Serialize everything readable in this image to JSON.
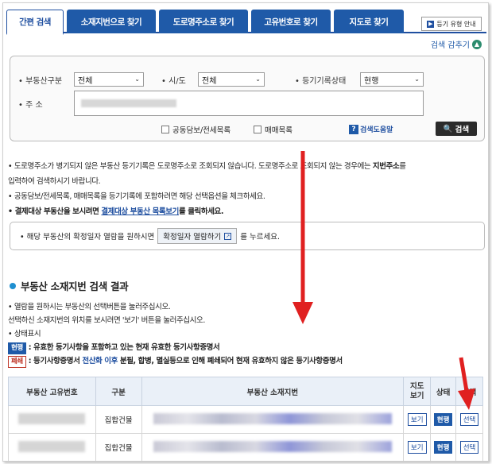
{
  "tabs": [
    {
      "label": "간편 검색",
      "active": true
    },
    {
      "label": "소재지번으로 찾기"
    },
    {
      "label": "도로명주소로 찾기"
    },
    {
      "label": "고유번호로 찾기"
    },
    {
      "label": "지도로 찾기"
    }
  ],
  "guide_button": "등기 유형 안내",
  "fold_label": "검색 감추기",
  "search": {
    "property_type": {
      "label": "• 부동산구분",
      "value": "전체"
    },
    "sido": {
      "label": "• 시/도",
      "value": "전체"
    },
    "record_status": {
      "label": "• 등기기록상태",
      "value": "현행"
    },
    "address": {
      "label": "• 주  소"
    },
    "check_joint": "공동담보/전세목록",
    "check_trade": "매매목록",
    "help": "검색도움말",
    "search_button": "검색"
  },
  "notes": {
    "line1a": "• 도로명주소가 병기되지 않은 부동산 등기기록은 도로명주소로 조회되지 않습니다. 도로명주소로 조회되지 않는 경우에는 ",
    "line1b": "지번주소",
    "line1c": "를",
    "line2": "  입력하여 검색하시기 바랍니다.",
    "line3": "• 공동담보/전세목록, 매매목록을 등기기록에 포함하려면 해당 선택옵션을 체크하세요.",
    "line4a": "• 결제대상 부동산을 보시려면 ",
    "line4b": "결제대상 부동산 목록보기",
    "line4c": "를 클릭하세요."
  },
  "datebox": {
    "pre": "• 해당 부동산의 확정일자 열람을 원하시면",
    "button": "확정일자 열람하기",
    "post": "를 누르세요."
  },
  "result": {
    "title": "부동산 소재지번 검색 결과",
    "note1": "• 열람을 원하시는 부동산의 선택버튼을 눌러주십시오.",
    "note2": "  선택하신 소재지번의 위치를 보시려면 '보기' 버튼을 눌러주십시오.",
    "note3": "• 상태표시",
    "legend_current_badge": "현행",
    "legend_current": " : 유효한 등기사항을 포함하고 있는 현재 유효한 등기사항증명서",
    "legend_closed_badge": "폐쇄",
    "legend_closed_a": " : 등기사항증명서 ",
    "legend_closed_b": "전산화 이후",
    "legend_closed_c": " 분필, 합병, 멸실등으로 인해 폐쇄되어 현재 유효하지 않은 등기사항증명서"
  },
  "table": {
    "headers": [
      "부동산 고유번호",
      "구분",
      "부동산 소재지번",
      "지도\n보기",
      "상태",
      "선택"
    ],
    "rows": [
      {
        "type": "집합건물",
        "map": "보기",
        "status": "현행",
        "select": "선택"
      },
      {
        "type": "집합건물",
        "map": "보기",
        "status": "현행",
        "select": "선택"
      }
    ]
  },
  "colors": {
    "primary": "#1f5aa8",
    "annotation_arrow": "#e02020"
  }
}
